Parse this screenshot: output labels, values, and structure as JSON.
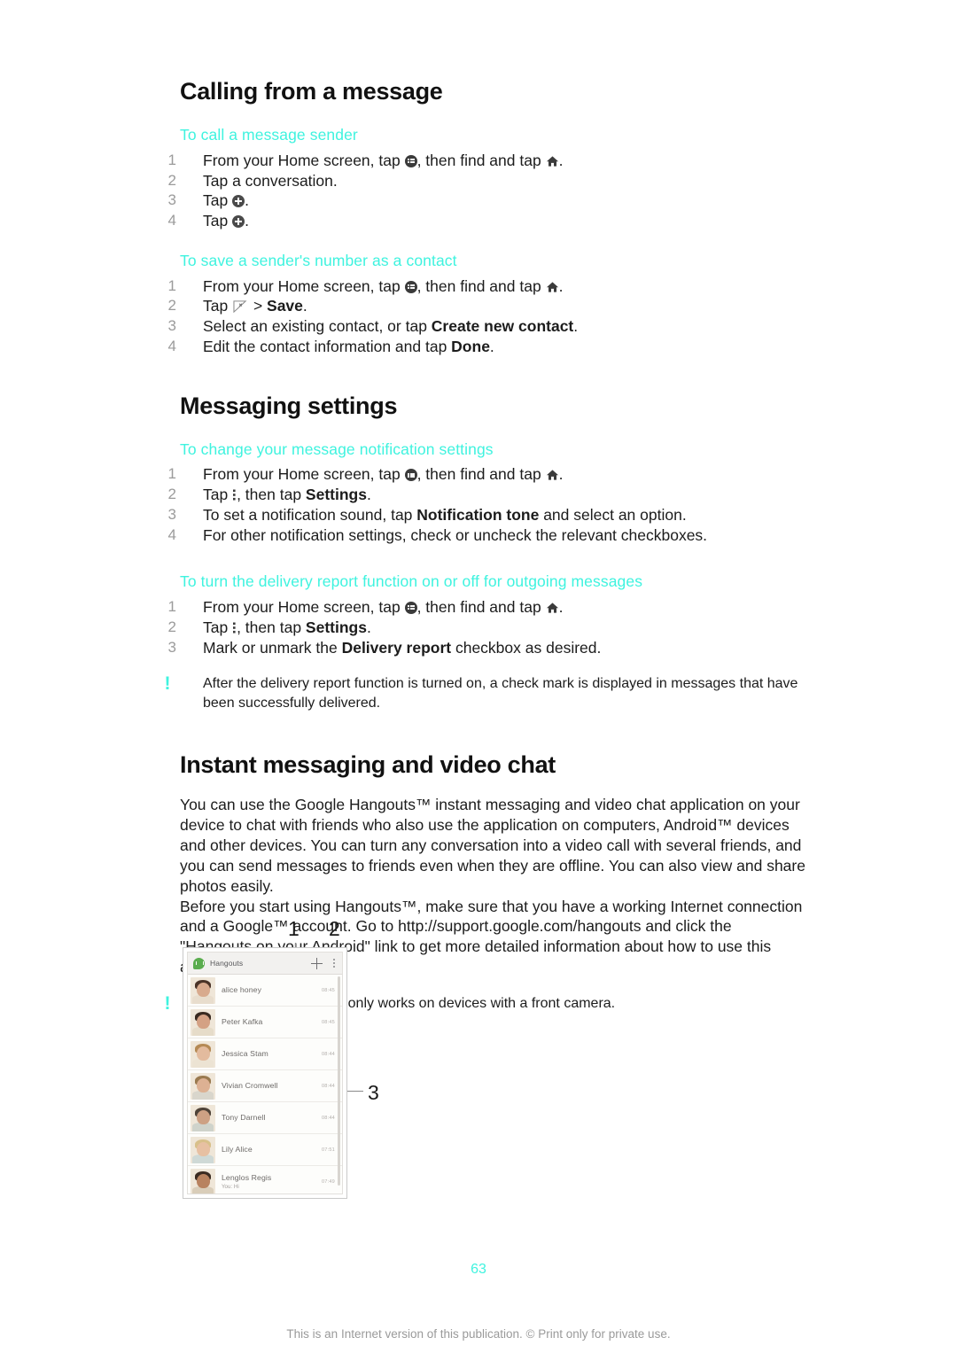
{
  "page": {
    "number": "63",
    "footer_note": "This is an Internet version of this publication. © Print only for private use."
  },
  "sections": [
    {
      "title": "Calling from a message",
      "subsections": [
        {
          "heading": "To call a message sender",
          "steps": [
            "From your Home screen, tap [appdrawer], then find and tap [home].",
            "Tap a conversation.",
            "Tap [plus].",
            "Tap [plus]."
          ]
        },
        {
          "heading": "To save a sender's number as a contact",
          "steps": [
            "From your Home screen, tap [appdrawer], then find and tap [home].",
            "Tap [flag] > Save.",
            "Select an existing contact, or tap Create new contact.",
            "Edit the contact information and tap Done."
          ]
        }
      ]
    },
    {
      "title": "Messaging settings",
      "subsections": [
        {
          "heading": "To change your message notification settings",
          "steps": [
            "From your Home screen, tap [appdrawer], then find and tap [home].",
            "Tap [kebab], then tap Settings.",
            "To set a notification sound, tap Notification tone and select an option.",
            "For other notification settings, check or uncheck the relevant checkboxes."
          ]
        },
        {
          "heading": "To turn the delivery report function on or off for outgoing messages",
          "steps": [
            "From your Home screen, tap [appdrawer], then find and tap [home].",
            "Tap [kebab], then tap Settings.",
            "Mark or unmark the Delivery report checkbox as desired."
          ],
          "note": "After the delivery report function is turned on, a check mark is displayed in messages that have been successfully delivered."
        }
      ]
    },
    {
      "title": "Instant messaging and video chat",
      "paragraphs": [
        "You can use the Google Hangouts™ instant messaging and video chat application on your device to chat with friends who also use the application on computers, Android™ devices and other devices. You can turn any conversation into a video call with several friends, and you can send messages to friends even when they are offline. You can also view and share photos easily.",
        "Before you start using Hangouts™, make sure that you have a working Internet connection and a Google™ account. Go to http://support.google.com/hangouts and click the \"Hangouts on your Android\" link to get more detailed information about how to use this application."
      ],
      "note": "The video call function only works on devices with a front camera."
    }
  ],
  "text_fragments": {
    "s1_1_a": "From your Home screen, tap ",
    "s1_1_b": ", then find and tap ",
    "s1_1_c": ".",
    "tap": "Tap ",
    "tap_a_conversation": "Tap a conversation.",
    "dot": ".",
    "gt_save_pre": " > ",
    "save_bold": "Save",
    "select_existing_pre": "Select an existing contact, or tap ",
    "create_new_contact_bold": "Create new contact",
    "edit_contact_pre": "Edit the contact information and tap ",
    "done_bold": "Done",
    "then_tap": ", then tap ",
    "settings_bold": "Settings",
    "notif_sound_pre": "To set a notification sound, tap ",
    "notification_tone_bold": "Notification tone",
    "notif_sound_post": " and select an option.",
    "other_notif": "For other notification settings, check or uncheck the relevant checkboxes.",
    "mark_unmark_pre": "Mark or unmark the ",
    "delivery_report_bold": "Delivery report",
    "mark_unmark_post": " checkbox as desired.",
    "bang": "!"
  },
  "figure": {
    "callouts": [
      {
        "label": "1"
      },
      {
        "label": "2"
      },
      {
        "label": "3"
      }
    ],
    "app": {
      "title": "Hangouts",
      "logo_icon": "hangouts-logo-icon",
      "add_icon": "plus-icon",
      "overflow_icon": "kebab-menu-icon",
      "accent_color": "#5aad4e",
      "conversations": [
        {
          "name": "alice honey",
          "time": "08:45",
          "preview": "",
          "avatar_colors": {
            "hair": "#4a3327",
            "skin": "#d8aa8d",
            "body": "#e8ddcd"
          }
        },
        {
          "name": "Peter Kafka",
          "time": "08:45",
          "preview": "",
          "avatar_colors": {
            "hair": "#3a2a20",
            "skin": "#d4a184",
            "body": "#e6dcc9"
          }
        },
        {
          "name": "Jessica Stam",
          "time": "08:44",
          "preview": "",
          "avatar_colors": {
            "hair": "#b58a55",
            "skin": "#e3bb9e",
            "body": "#ece3d3"
          }
        },
        {
          "name": "Vivian Cromwell",
          "time": "08:44",
          "preview": "",
          "avatar_colors": {
            "hair": "#9a7a4f",
            "skin": "#ddb193",
            "body": "#d9d6cc"
          }
        },
        {
          "name": "Tony Darnell",
          "time": "08:44",
          "preview": "",
          "avatar_colors": {
            "hair": "#4f4338",
            "skin": "#cda184",
            "body": "#cfd3cb"
          }
        },
        {
          "name": "Lily Alice",
          "time": "07:51",
          "preview": "",
          "avatar_colors": {
            "hair": "#d8c08a",
            "skin": "#e7c0a2",
            "body": "#cfd9d6"
          }
        },
        {
          "name": "Lenglos Regis",
          "time": "07:49",
          "preview": "You: Hi",
          "avatar_colors": {
            "hair": "#3b2b21",
            "skin": "#b8825f",
            "body": "#d9cdb9"
          }
        }
      ]
    }
  },
  "colors": {
    "accent_heading": "#3ff3df",
    "body_text": "#1c1c1c",
    "step_number": "#9b9b9b",
    "footer_text": "#9a9a9a"
  }
}
